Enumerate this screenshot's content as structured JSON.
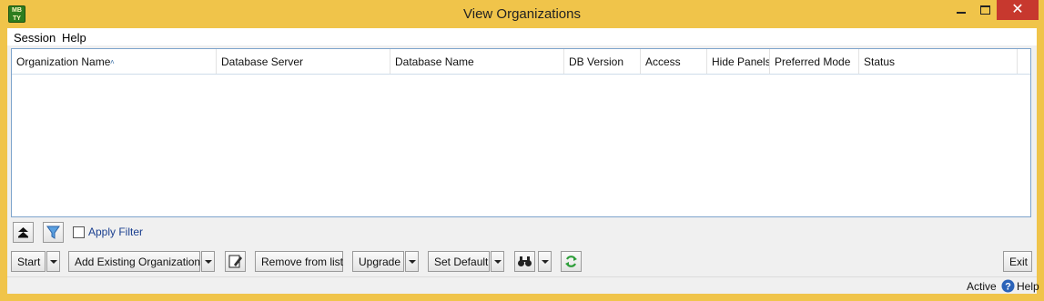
{
  "window": {
    "title": "View Organizations",
    "app_icon_text": "MB\nTY",
    "close_glyph": "✕"
  },
  "menu": {
    "session": "Session",
    "help": "Help"
  },
  "grid": {
    "sort_indicator": "˄",
    "columns": [
      "Organization Name",
      "Database Server",
      "Database Name",
      "DB Version",
      "Access",
      "Hide Panels",
      "Preferred Mode",
      "Status"
    ],
    "rows": []
  },
  "filter": {
    "apply_filter_label": "Apply Filter",
    "checked": false
  },
  "buttons": {
    "start": "Start",
    "add_existing": "Add Existing Organization",
    "remove": "Remove from list",
    "upgrade": "Upgrade",
    "set_default": "Set Default",
    "exit": "Exit"
  },
  "status": {
    "state": "Active",
    "help": "Help"
  },
  "icons": {
    "app": "app-logo-icon",
    "collapse": "collapse-up-icon",
    "filter": "filter-funnel-icon",
    "edit": "edit-document-icon",
    "find": "binoculars-icon",
    "refresh": "refresh-icon",
    "help": "help-circle-icon"
  },
  "colors": {
    "frame": "#f0c44a",
    "close_button": "#c7382e",
    "grid_border": "#7ea4cc",
    "link_text": "#1a3f8f"
  }
}
